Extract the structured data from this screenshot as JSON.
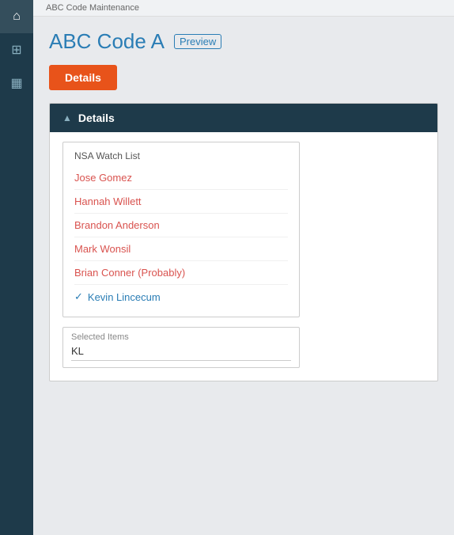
{
  "breadcrumb": "ABC Code Maintenance",
  "page": {
    "title": "ABC Code A",
    "preview_label": "Preview"
  },
  "buttons": {
    "details_label": "Details"
  },
  "section": {
    "header_label": "Details",
    "watch_list": {
      "title": "NSA Watch List",
      "items": [
        {
          "name": "Jose Gomez",
          "selected": false
        },
        {
          "name": "Hannah Willett",
          "selected": false
        },
        {
          "name": "Brandon Anderson",
          "selected": false
        },
        {
          "name": "Mark Wonsil",
          "selected": false
        },
        {
          "name": "Brian Conner (Probably)",
          "selected": false
        },
        {
          "name": "Kevin Lincecum",
          "selected": true
        }
      ]
    },
    "selected_items": {
      "label": "Selected Items",
      "value": "KL"
    }
  },
  "sidebar": {
    "icons": [
      {
        "name": "home-icon",
        "symbol": "⌂"
      },
      {
        "name": "grid-icon",
        "symbol": "⊞"
      },
      {
        "name": "table-icon",
        "symbol": "▦"
      }
    ]
  }
}
